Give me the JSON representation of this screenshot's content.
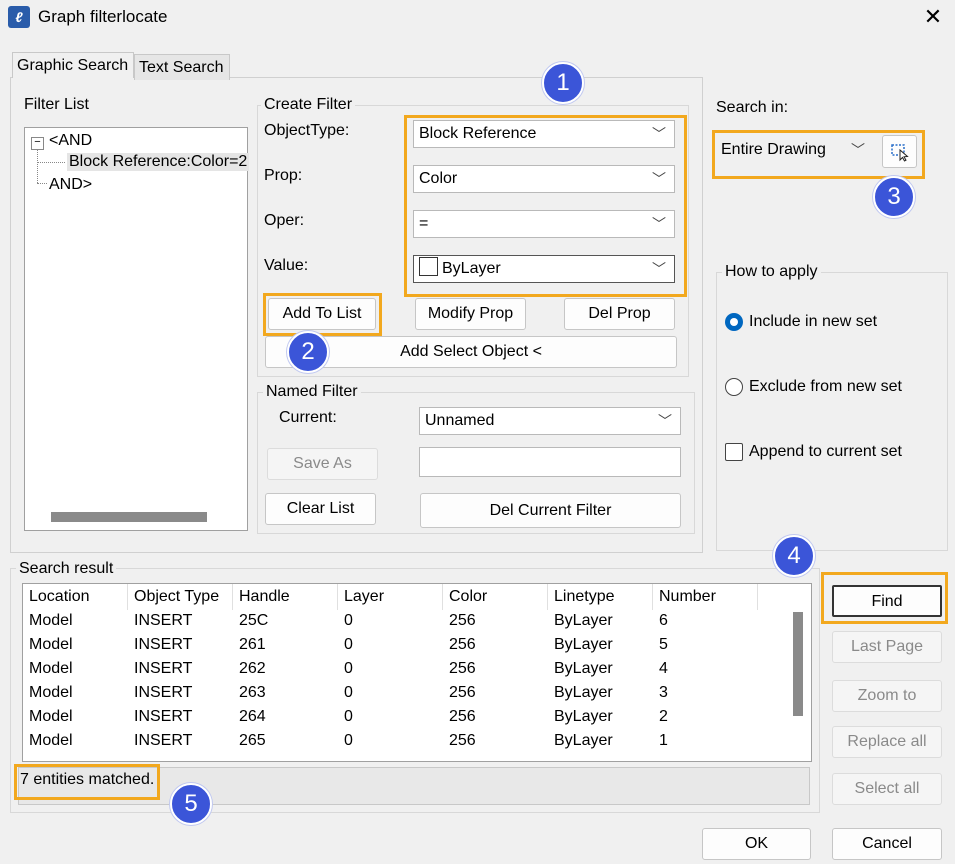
{
  "window": {
    "title": "Graph filterlocate"
  },
  "tabs": [
    {
      "label": "Graphic Search",
      "active": true
    },
    {
      "label": "Text Search",
      "active": false
    }
  ],
  "filter_list": {
    "label": "Filter List",
    "items": [
      "<AND",
      "Block Reference:Color=2",
      "AND>"
    ],
    "expand_glyph": "−"
  },
  "create_filter": {
    "label": "Create Filter",
    "objecttype": {
      "label": "ObjectType:",
      "value": "Block Reference"
    },
    "prop": {
      "label": "Prop:",
      "value": "Color"
    },
    "oper": {
      "label": "Oper:",
      "value": "="
    },
    "value": {
      "label": "Value:",
      "value": "ByLayer"
    },
    "add_to_list": "Add To List",
    "modify_prop": "Modify Prop",
    "del_prop": "Del Prop",
    "add_select_object": "Add Select Object <"
  },
  "named_filter": {
    "label": "Named Filter",
    "current_label": "Current:",
    "current_value": "Unnamed",
    "save_as": "Save As",
    "name_input": "",
    "clear_list": "Clear List",
    "del_current_filter": "Del Current Filter"
  },
  "search_in": {
    "label": "Search in:",
    "value": "Entire Drawing"
  },
  "how_to_apply": {
    "label": "How to apply",
    "include": "Include in new set",
    "exclude": "Exclude from new set",
    "append": "Append to current set",
    "selected": "include",
    "append_checked": false
  },
  "search_result": {
    "label": "Search result",
    "columns": [
      "Location",
      "Object Type",
      "Handle",
      "Layer",
      "Color",
      "Linetype",
      "Number"
    ],
    "rows": [
      [
        "Model",
        "INSERT",
        "25C",
        "0",
        "256",
        "ByLayer",
        "6"
      ],
      [
        "Model",
        "INSERT",
        "261",
        "0",
        "256",
        "ByLayer",
        "5"
      ],
      [
        "Model",
        "INSERT",
        "262",
        "0",
        "256",
        "ByLayer",
        "4"
      ],
      [
        "Model",
        "INSERT",
        "263",
        "0",
        "256",
        "ByLayer",
        "3"
      ],
      [
        "Model",
        "INSERT",
        "264",
        "0",
        "256",
        "ByLayer",
        "2"
      ],
      [
        "Model",
        "INSERT",
        "265",
        "0",
        "256",
        "ByLayer",
        "1"
      ]
    ],
    "status": "7 entities matched."
  },
  "actions": {
    "find": "Find",
    "last_page": "Last Page",
    "zoom_to": "Zoom to",
    "replace_all": "Replace all",
    "select_all": "Select all",
    "ok": "OK",
    "cancel": "Cancel"
  },
  "callouts": [
    "1",
    "2",
    "3",
    "4",
    "5"
  ],
  "colors": {
    "highlight": "#f2a81e",
    "badge": "#3b55d8",
    "radio_selected": "#0067c0"
  }
}
